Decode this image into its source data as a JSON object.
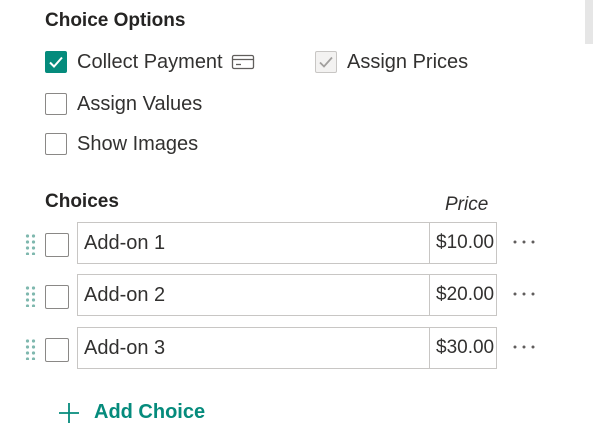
{
  "choice_options": {
    "title": "Choice Options",
    "collect_payment": {
      "label": "Collect Payment",
      "checked": true
    },
    "assign_prices": {
      "label": "Assign Prices",
      "checked": true,
      "disabled": true
    },
    "assign_values": {
      "label": "Assign Values",
      "checked": false
    },
    "show_images": {
      "label": "Show Images",
      "checked": false
    }
  },
  "choices": {
    "title": "Choices",
    "price_header": "Price",
    "items": [
      {
        "label": "Add-on 1",
        "price": "$10.00"
      },
      {
        "label": "Add-on 2",
        "price": "$20.00"
      },
      {
        "label": "Add-on 3",
        "price": "$30.00"
      }
    ],
    "add_label": "Add Choice"
  },
  "colors": {
    "accent": "#058b7c",
    "border": "#c8c6c4",
    "text": "#323130"
  },
  "icons": {
    "payment": "credit-card-icon",
    "drag": "drag-handle-icon",
    "more": "more-options-icon",
    "add": "plus-icon"
  }
}
